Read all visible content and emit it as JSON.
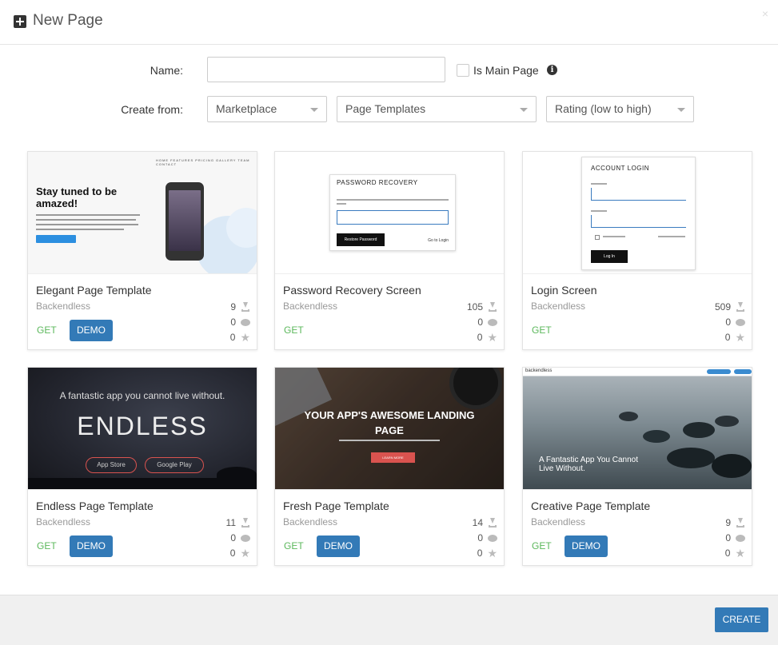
{
  "dialog": {
    "title": "New Page",
    "close": "×"
  },
  "form": {
    "name_label": "Name:",
    "name_value": "",
    "is_main_label": "Is Main Page",
    "create_from_label": "Create from:",
    "source_select": "Marketplace",
    "type_select": "Page Templates",
    "sort_select": "Rating (low to high)"
  },
  "cards": [
    {
      "title": "Elegant Page Template",
      "author": "Backendless",
      "downloads": "9",
      "comments": "0",
      "stars": "0",
      "get": "GET",
      "demo": "DEMO",
      "thumb": {
        "heading": "Stay tuned to be amazed!",
        "nav": "HOME FEATURES PRICING GALLERY TEAM CONTACT"
      }
    },
    {
      "title": "Password Recovery Screen",
      "author": "Backendless",
      "downloads": "105",
      "comments": "0",
      "stars": "0",
      "get": "GET",
      "thumb": {
        "heading": "PASSWORD RECOVERY",
        "button": "Restore Password",
        "link": "Go to Login"
      }
    },
    {
      "title": "Login Screen",
      "author": "Backendless",
      "downloads": "509",
      "comments": "0",
      "stars": "0",
      "get": "GET",
      "thumb": {
        "heading": "ACCOUNT LOGIN",
        "button": "Log In"
      }
    },
    {
      "title": "Endless Page Template",
      "author": "Backendless",
      "downloads": "11",
      "comments": "0",
      "stars": "0",
      "get": "GET",
      "demo": "DEMO",
      "thumb": {
        "tagline": "A fantastic app you cannot live without.",
        "heading": "ENDLESS",
        "btn1": "App Store",
        "btn2": "Google Play"
      }
    },
    {
      "title": "Fresh Page Template",
      "author": "Backendless",
      "downloads": "14",
      "comments": "0",
      "stars": "0",
      "get": "GET",
      "demo": "DEMO",
      "thumb": {
        "heading": "YOUR APP'S AWESOME LANDING PAGE",
        "button": "LEARN MORE"
      }
    },
    {
      "title": "Creative Page Template",
      "author": "Backendless",
      "downloads": "9",
      "comments": "0",
      "stars": "0",
      "get": "GET",
      "demo": "DEMO",
      "thumb": {
        "logo": "backendless",
        "tagline": "A Fantastic App You Cannot Live Without."
      }
    }
  ],
  "footer": {
    "create": "CREATE"
  },
  "colors": {
    "primary": "#337ab7",
    "get_green": "#5cb85c",
    "footer_bg": "#f0f0f0"
  }
}
